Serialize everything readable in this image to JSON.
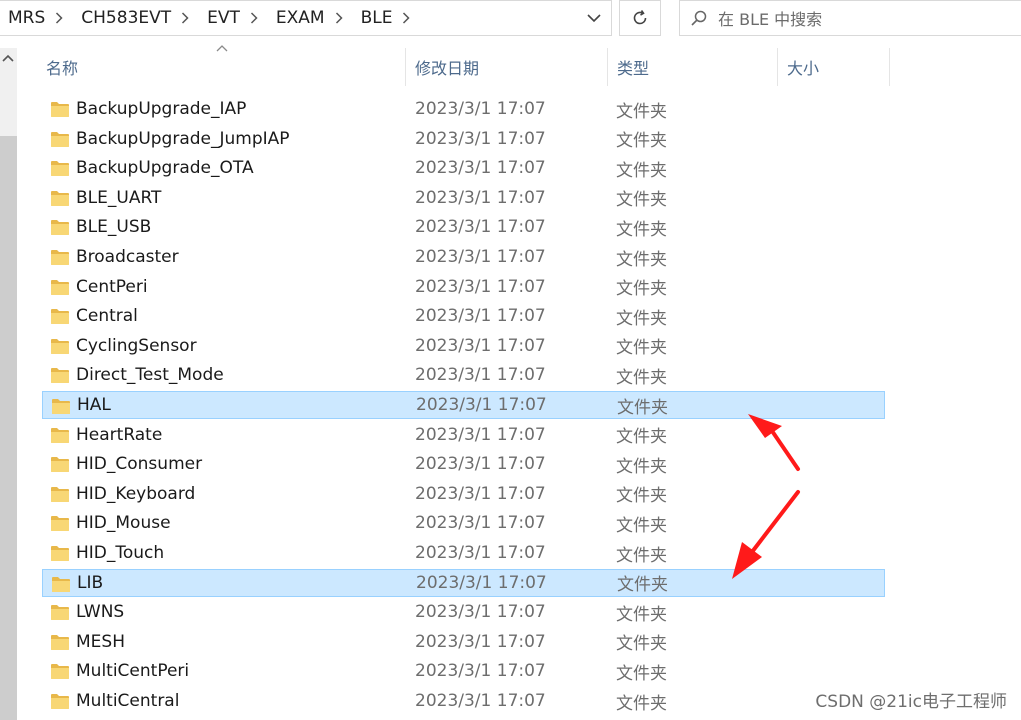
{
  "address_bar": {
    "breadcrumbs": [
      "MRS",
      "CH583EVT",
      "EVT",
      "EXAM",
      "BLE"
    ]
  },
  "search": {
    "placeholder": "在 BLE 中搜索"
  },
  "columns": {
    "name": "名称",
    "date": "修改日期",
    "type": "类型",
    "size": "大小"
  },
  "rows": [
    {
      "name": "BackupUpgrade_IAP",
      "date": "2023/3/1 17:07",
      "type": "文件夹",
      "selected": false
    },
    {
      "name": "BackupUpgrade_JumpIAP",
      "date": "2023/3/1 17:07",
      "type": "文件夹",
      "selected": false
    },
    {
      "name": "BackupUpgrade_OTA",
      "date": "2023/3/1 17:07",
      "type": "文件夹",
      "selected": false
    },
    {
      "name": "BLE_UART",
      "date": "2023/3/1 17:07",
      "type": "文件夹",
      "selected": false
    },
    {
      "name": "BLE_USB",
      "date": "2023/3/1 17:07",
      "type": "文件夹",
      "selected": false
    },
    {
      "name": "Broadcaster",
      "date": "2023/3/1 17:07",
      "type": "文件夹",
      "selected": false
    },
    {
      "name": "CentPeri",
      "date": "2023/3/1 17:07",
      "type": "文件夹",
      "selected": false
    },
    {
      "name": "Central",
      "date": "2023/3/1 17:07",
      "type": "文件夹",
      "selected": false
    },
    {
      "name": "CyclingSensor",
      "date": "2023/3/1 17:07",
      "type": "文件夹",
      "selected": false
    },
    {
      "name": "Direct_Test_Mode",
      "date": "2023/3/1 17:07",
      "type": "文件夹",
      "selected": false
    },
    {
      "name": "HAL",
      "date": "2023/3/1 17:07",
      "type": "文件夹",
      "selected": true
    },
    {
      "name": "HeartRate",
      "date": "2023/3/1 17:07",
      "type": "文件夹",
      "selected": false
    },
    {
      "name": "HID_Consumer",
      "date": "2023/3/1 17:07",
      "type": "文件夹",
      "selected": false
    },
    {
      "name": "HID_Keyboard",
      "date": "2023/3/1 17:07",
      "type": "文件夹",
      "selected": false
    },
    {
      "name": "HID_Mouse",
      "date": "2023/3/1 17:07",
      "type": "文件夹",
      "selected": false
    },
    {
      "name": "HID_Touch",
      "date": "2023/3/1 17:07",
      "type": "文件夹",
      "selected": false
    },
    {
      "name": "LIB",
      "date": "2023/3/1 17:07",
      "type": "文件夹",
      "selected": true
    },
    {
      "name": "LWNS",
      "date": "2023/3/1 17:07",
      "type": "文件夹",
      "selected": false
    },
    {
      "name": "MESH",
      "date": "2023/3/1 17:07",
      "type": "文件夹",
      "selected": false
    },
    {
      "name": "MultiCentPeri",
      "date": "2023/3/1 17:07",
      "type": "文件夹",
      "selected": false
    },
    {
      "name": "MultiCentral",
      "date": "2023/3/1 17:07",
      "type": "文件夹",
      "selected": false
    }
  ],
  "icons": {
    "folder": "folder-icon",
    "search": "search-icon",
    "refresh": "refresh-icon",
    "breadcrumb_separator": "chevron-right-icon",
    "address_dropdown": "chevron-down-icon",
    "sort": "sort-ascending-icon"
  },
  "colors": {
    "selection_bg": "#cce8ff",
    "selection_border": "#99d1ff",
    "folder": "#f8d775",
    "annotation_arrow": "#ff1a1a",
    "header_text": "#4d6a8c"
  },
  "watermark": "CSDN @21ic电子工程师"
}
